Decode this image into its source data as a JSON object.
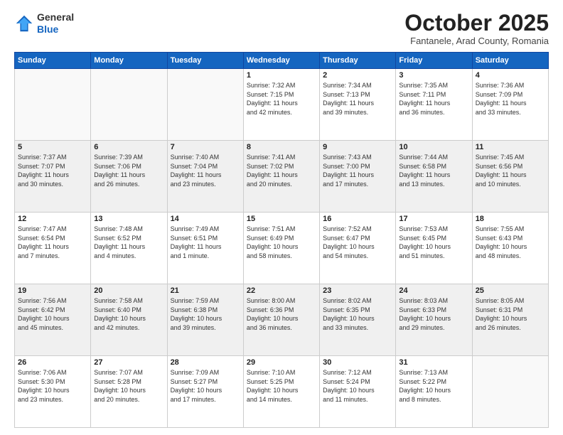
{
  "header": {
    "logo_line1": "General",
    "logo_line2": "Blue",
    "month": "October 2025",
    "location": "Fantanele, Arad County, Romania"
  },
  "weekdays": [
    "Sunday",
    "Monday",
    "Tuesday",
    "Wednesday",
    "Thursday",
    "Friday",
    "Saturday"
  ],
  "weeks": [
    [
      {
        "day": "",
        "info": ""
      },
      {
        "day": "",
        "info": ""
      },
      {
        "day": "",
        "info": ""
      },
      {
        "day": "1",
        "info": "Sunrise: 7:32 AM\nSunset: 7:15 PM\nDaylight: 11 hours\nand 42 minutes."
      },
      {
        "day": "2",
        "info": "Sunrise: 7:34 AM\nSunset: 7:13 PM\nDaylight: 11 hours\nand 39 minutes."
      },
      {
        "day": "3",
        "info": "Sunrise: 7:35 AM\nSunset: 7:11 PM\nDaylight: 11 hours\nand 36 minutes."
      },
      {
        "day": "4",
        "info": "Sunrise: 7:36 AM\nSunset: 7:09 PM\nDaylight: 11 hours\nand 33 minutes."
      }
    ],
    [
      {
        "day": "5",
        "info": "Sunrise: 7:37 AM\nSunset: 7:07 PM\nDaylight: 11 hours\nand 30 minutes."
      },
      {
        "day": "6",
        "info": "Sunrise: 7:39 AM\nSunset: 7:06 PM\nDaylight: 11 hours\nand 26 minutes."
      },
      {
        "day": "7",
        "info": "Sunrise: 7:40 AM\nSunset: 7:04 PM\nDaylight: 11 hours\nand 23 minutes."
      },
      {
        "day": "8",
        "info": "Sunrise: 7:41 AM\nSunset: 7:02 PM\nDaylight: 11 hours\nand 20 minutes."
      },
      {
        "day": "9",
        "info": "Sunrise: 7:43 AM\nSunset: 7:00 PM\nDaylight: 11 hours\nand 17 minutes."
      },
      {
        "day": "10",
        "info": "Sunrise: 7:44 AM\nSunset: 6:58 PM\nDaylight: 11 hours\nand 13 minutes."
      },
      {
        "day": "11",
        "info": "Sunrise: 7:45 AM\nSunset: 6:56 PM\nDaylight: 11 hours\nand 10 minutes."
      }
    ],
    [
      {
        "day": "12",
        "info": "Sunrise: 7:47 AM\nSunset: 6:54 PM\nDaylight: 11 hours\nand 7 minutes."
      },
      {
        "day": "13",
        "info": "Sunrise: 7:48 AM\nSunset: 6:52 PM\nDaylight: 11 hours\nand 4 minutes."
      },
      {
        "day": "14",
        "info": "Sunrise: 7:49 AM\nSunset: 6:51 PM\nDaylight: 11 hours\nand 1 minute."
      },
      {
        "day": "15",
        "info": "Sunrise: 7:51 AM\nSunset: 6:49 PM\nDaylight: 10 hours\nand 58 minutes."
      },
      {
        "day": "16",
        "info": "Sunrise: 7:52 AM\nSunset: 6:47 PM\nDaylight: 10 hours\nand 54 minutes."
      },
      {
        "day": "17",
        "info": "Sunrise: 7:53 AM\nSunset: 6:45 PM\nDaylight: 10 hours\nand 51 minutes."
      },
      {
        "day": "18",
        "info": "Sunrise: 7:55 AM\nSunset: 6:43 PM\nDaylight: 10 hours\nand 48 minutes."
      }
    ],
    [
      {
        "day": "19",
        "info": "Sunrise: 7:56 AM\nSunset: 6:42 PM\nDaylight: 10 hours\nand 45 minutes."
      },
      {
        "day": "20",
        "info": "Sunrise: 7:58 AM\nSunset: 6:40 PM\nDaylight: 10 hours\nand 42 minutes."
      },
      {
        "day": "21",
        "info": "Sunrise: 7:59 AM\nSunset: 6:38 PM\nDaylight: 10 hours\nand 39 minutes."
      },
      {
        "day": "22",
        "info": "Sunrise: 8:00 AM\nSunset: 6:36 PM\nDaylight: 10 hours\nand 36 minutes."
      },
      {
        "day": "23",
        "info": "Sunrise: 8:02 AM\nSunset: 6:35 PM\nDaylight: 10 hours\nand 33 minutes."
      },
      {
        "day": "24",
        "info": "Sunrise: 8:03 AM\nSunset: 6:33 PM\nDaylight: 10 hours\nand 29 minutes."
      },
      {
        "day": "25",
        "info": "Sunrise: 8:05 AM\nSunset: 6:31 PM\nDaylight: 10 hours\nand 26 minutes."
      }
    ],
    [
      {
        "day": "26",
        "info": "Sunrise: 7:06 AM\nSunset: 5:30 PM\nDaylight: 10 hours\nand 23 minutes."
      },
      {
        "day": "27",
        "info": "Sunrise: 7:07 AM\nSunset: 5:28 PM\nDaylight: 10 hours\nand 20 minutes."
      },
      {
        "day": "28",
        "info": "Sunrise: 7:09 AM\nSunset: 5:27 PM\nDaylight: 10 hours\nand 17 minutes."
      },
      {
        "day": "29",
        "info": "Sunrise: 7:10 AM\nSunset: 5:25 PM\nDaylight: 10 hours\nand 14 minutes."
      },
      {
        "day": "30",
        "info": "Sunrise: 7:12 AM\nSunset: 5:24 PM\nDaylight: 10 hours\nand 11 minutes."
      },
      {
        "day": "31",
        "info": "Sunrise: 7:13 AM\nSunset: 5:22 PM\nDaylight: 10 hours\nand 8 minutes."
      },
      {
        "day": "",
        "info": ""
      }
    ]
  ]
}
